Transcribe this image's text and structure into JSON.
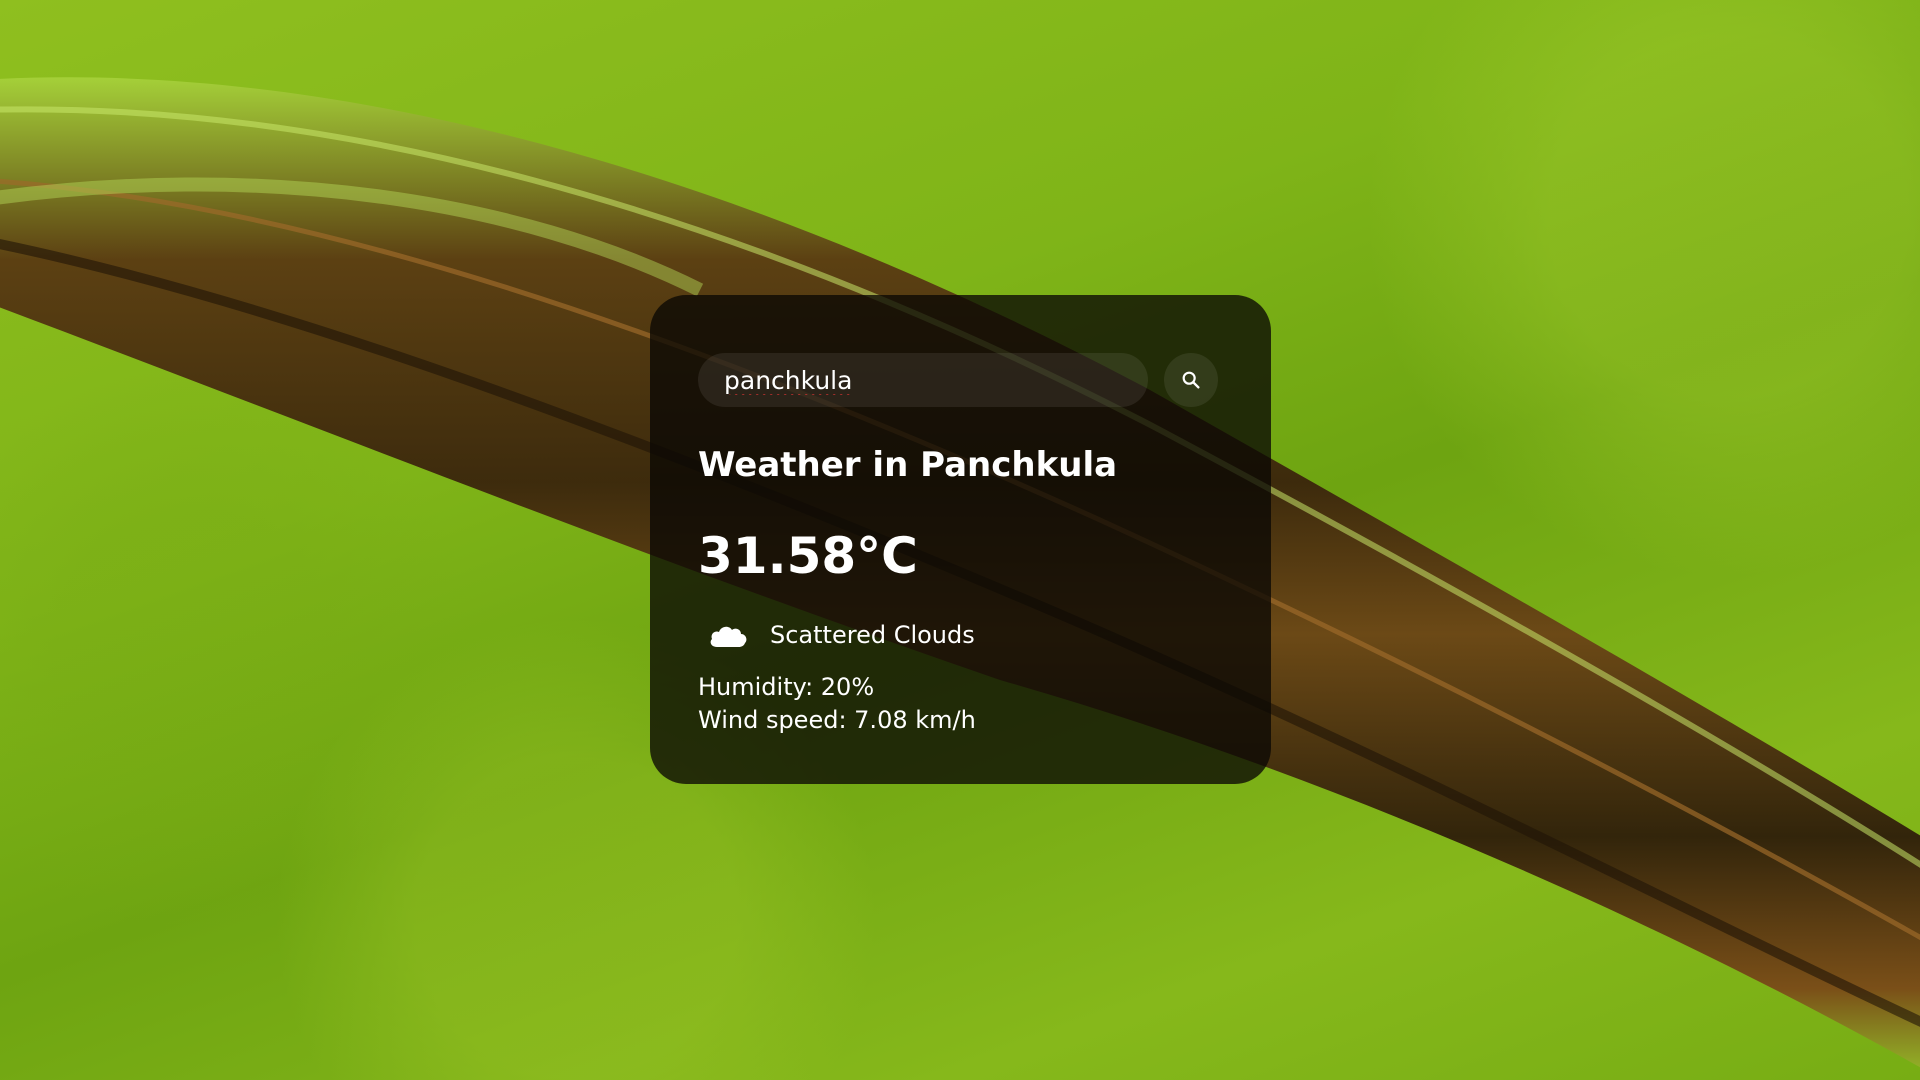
{
  "search": {
    "value": "panchkula",
    "placeholder": "Search",
    "icon": "search-icon"
  },
  "weather": {
    "title": "Weather in Panchkula",
    "temperature": "31.58°C",
    "condition_icon": "cloud-icon",
    "description": "Scattered Clouds",
    "humidity": "Humidity: 20%",
    "wind": "Wind speed: 7.08 km/h"
  },
  "colors": {
    "card_background": "#0a0804",
    "text": "#ffffff",
    "background_green": "#7fb418"
  }
}
